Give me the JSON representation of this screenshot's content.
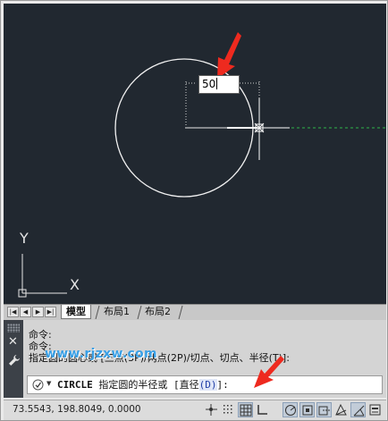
{
  "canvas": {
    "dynamic_input_value": "50",
    "ucs_x_label": "X",
    "ucs_y_label": "Y"
  },
  "layout_tabs": {
    "nav_buttons": [
      "|◀",
      "◀",
      "▶",
      "▶|"
    ],
    "tabs": [
      "模型",
      "布局1",
      "布局2"
    ],
    "active": "模型"
  },
  "command": {
    "history": [
      "命令:",
      "命令:",
      "指定圆的圆心或 [三点(3P)/两点(2P)/切点、切点、半径(T)]:"
    ],
    "watermark": "www.rjzxw.com",
    "prompt_name": "CIRCLE",
    "prompt_text": " 指定圆的半径或 [直径",
    "prompt_option": "(D)",
    "prompt_end": "]:"
  },
  "status": {
    "coordinates": "73.5543,  198.8049, 0.0000"
  },
  "colors": {
    "canvas_bg": "#212830",
    "annotation_red": "#ee2a1f",
    "tracking_green": "#2fb34a",
    "watermark_blue": "#3aa0e6"
  },
  "icons": [
    "close-icon",
    "wrench-icon",
    "command-icon",
    "snap-icon",
    "grid-icon",
    "ortho-icon",
    "polar-icon",
    "osnap-icon",
    "otrack-icon",
    "ducs-icon",
    "dyn-icon",
    "lineweight-icon",
    "quickprops-icon"
  ]
}
